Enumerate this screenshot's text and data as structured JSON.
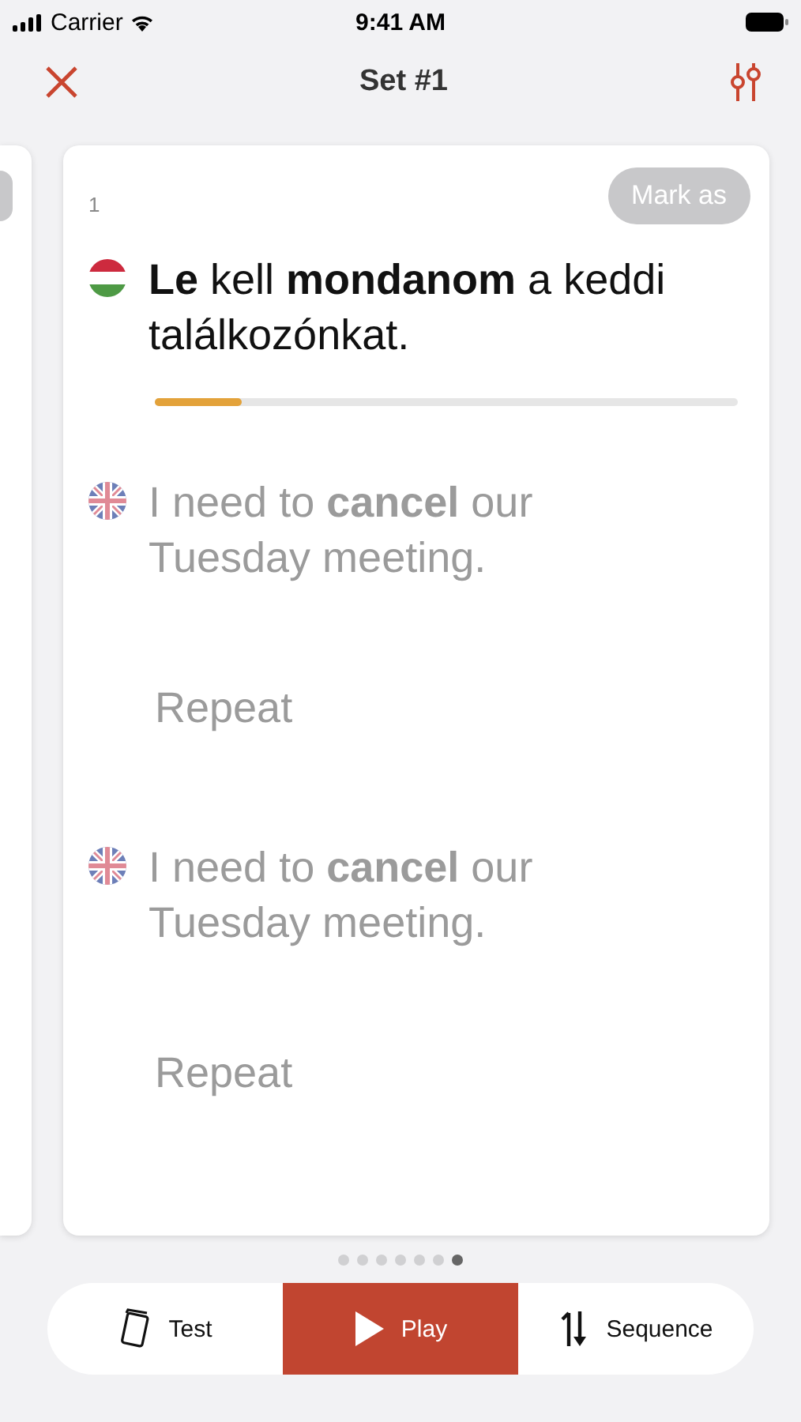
{
  "status_bar": {
    "carrier": "Carrier",
    "time": "9:41 AM"
  },
  "nav": {
    "title": "Set #1"
  },
  "card": {
    "number": "1",
    "mark_button": "Mark as",
    "lines": [
      {
        "kind": "native",
        "text": "**Le** kell **mondanom** a keddi találkozónkat."
      },
      {
        "kind": "progress",
        "level": 0.15
      },
      {
        "kind": "translation",
        "text": "I need to **cancel** our Tuesday meeting."
      },
      {
        "kind": "repeat",
        "text": "Repeat"
      },
      {
        "kind": "translation",
        "text": "I need to **cancel** our Tuesday meeting."
      },
      {
        "kind": "repeat",
        "text": "Repeat"
      }
    ]
  },
  "pager": [
    {
      "selected": false
    },
    {
      "selected": false
    },
    {
      "selected": false
    },
    {
      "selected": false
    },
    {
      "selected": false
    },
    {
      "selected": false
    },
    {
      "selected": true
    }
  ],
  "modes": [
    {
      "kind": "test",
      "label": "Test",
      "selected": false
    },
    {
      "kind": "play",
      "label": "Play",
      "selected": true
    },
    {
      "kind": "sequence",
      "label": "Sequence",
      "selected": false
    }
  ]
}
